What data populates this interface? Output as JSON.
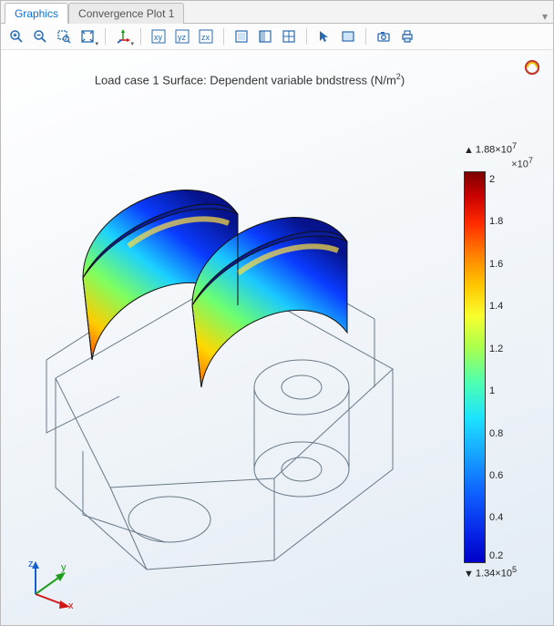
{
  "tabs": [
    {
      "label": "Graphics",
      "active": true
    },
    {
      "label": "Convergence Plot 1",
      "active": false
    }
  ],
  "plot": {
    "title_prefix": "Load case 1    Surface: Dependent variable bndstress (N/m",
    "title_exp": "2",
    "title_suffix": ")"
  },
  "colorbar": {
    "max_label": "1.88×10",
    "max_exp": "7",
    "scale_label": "×10",
    "scale_exp": "7",
    "ticks": [
      "2",
      "1.8",
      "1.6",
      "1.4",
      "1.2",
      "1",
      "0.8",
      "0.6",
      "0.4",
      "0.2"
    ],
    "min_label": "1.34×10",
    "min_exp": "5"
  },
  "axes": {
    "x": "x",
    "y": "y",
    "z": "z"
  },
  "toolbar": {
    "zoom_in": "Zoom In",
    "zoom_out": "Zoom Out",
    "zoom_box": "Zoom Box",
    "zoom_extents": "Zoom Extents",
    "xy": "xy",
    "yz": "yz",
    "zx": "zx"
  }
}
